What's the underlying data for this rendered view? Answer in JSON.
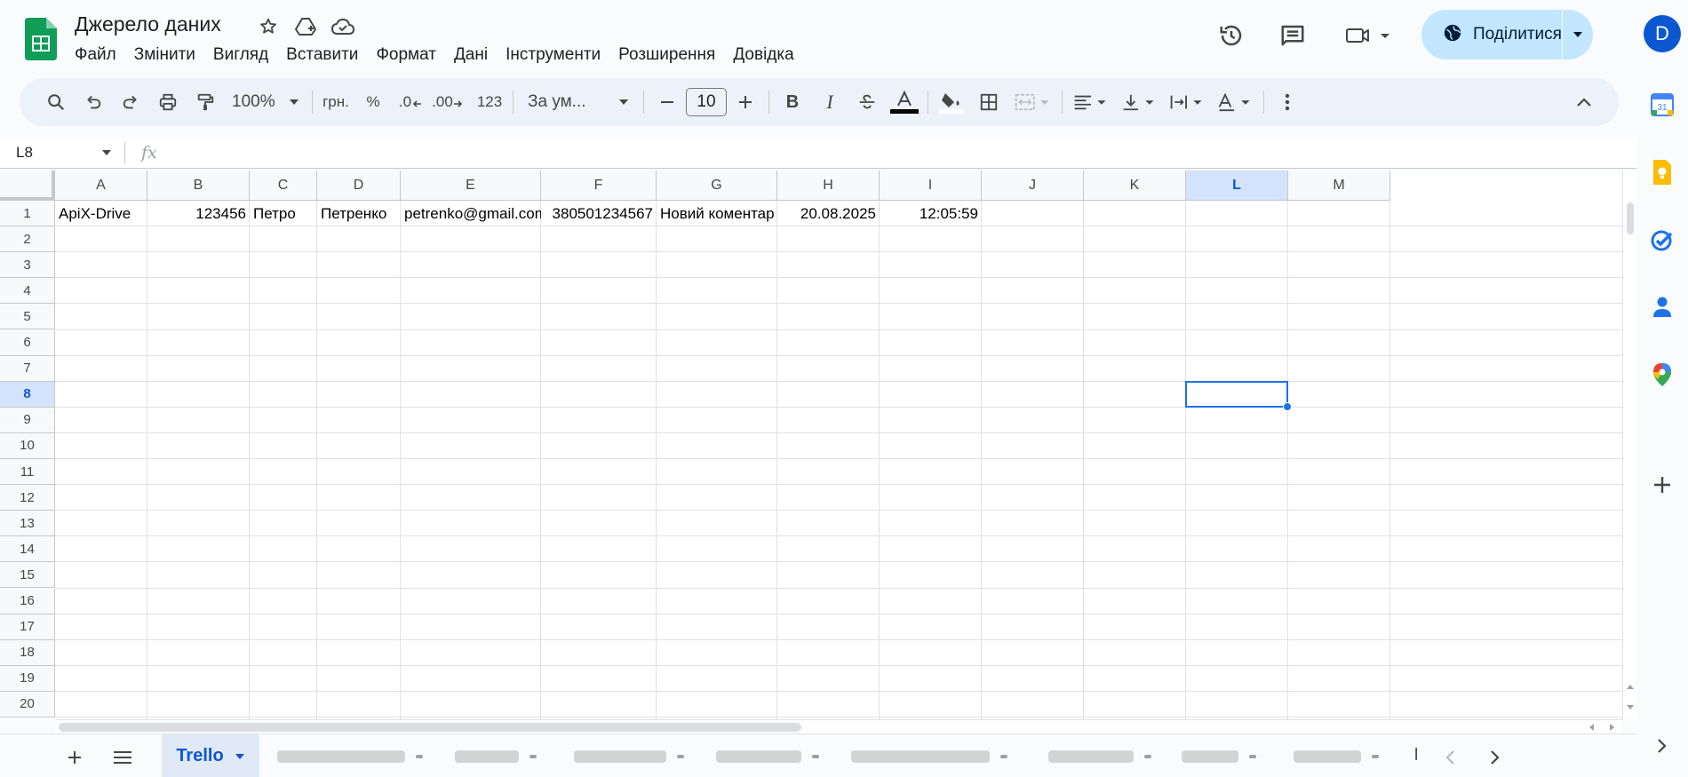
{
  "document": {
    "title": "Джерело даних"
  },
  "menu": [
    "Файл",
    "Змінити",
    "Вигляд",
    "Вставити",
    "Формат",
    "Дані",
    "Інструменти",
    "Розширення",
    "Довідка"
  ],
  "share": {
    "label": "Поділитися"
  },
  "account": {
    "initial": "D"
  },
  "toolbar": {
    "zoom": "100%",
    "currency": "грн.",
    "percent": "%",
    "decrease_decimals": ".0",
    "increase_decimals": ".00",
    "number_format": "123",
    "font_family": "За ум...",
    "font_size": "10",
    "bold": "B",
    "italic": "I"
  },
  "formula_bar": {
    "name_box": "L8",
    "fx": "fx",
    "content": ""
  },
  "grid": {
    "columns": [
      "A",
      "B",
      "C",
      "D",
      "E",
      "F",
      "G",
      "H",
      "I",
      "J",
      "K",
      "L",
      "M"
    ],
    "selected_column": "L",
    "rows": [
      "1",
      "2",
      "3",
      "4",
      "5",
      "6",
      "7",
      "8",
      "9",
      "10",
      "11",
      "12",
      "13",
      "14",
      "15",
      "16",
      "17",
      "18",
      "19",
      "20"
    ],
    "selected_row": "8",
    "selected_cell": "L8",
    "row1": [
      "ApiX-Drive",
      "123456",
      "Петро",
      "Петренко",
      "petrenko@gmail.com",
      "380501234567",
      "Новий коментар",
      "20.08.2025",
      "12:05:59"
    ]
  },
  "sheets": {
    "active": "Trello",
    "visible_partial": "l"
  },
  "colors": {
    "accent": "#0b57d0",
    "share_bg": "#c2e7ff",
    "selection": "#1a73e8",
    "sheets_green": "#0f9d58"
  }
}
